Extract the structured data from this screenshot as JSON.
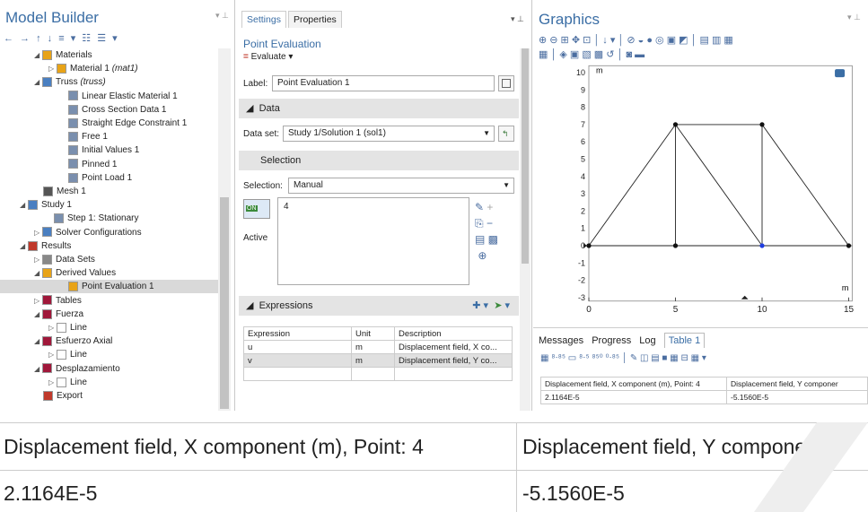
{
  "model_builder": {
    "title": "Model Builder",
    "toolbar_glyphs": "← → ↑ ↓ ≡ ▾ ☷ ☰ ▾",
    "tree": [
      {
        "indent": 48,
        "arrow": "◢",
        "icon": "#e8a317",
        "label": "Materials",
        "italic": ""
      },
      {
        "indent": 64,
        "arrow": "▷",
        "icon": "#e8a317",
        "label": "Material 1 ",
        "italic": "(mat1)"
      },
      {
        "indent": 48,
        "arrow": "◢",
        "icon": "#4a7fc1",
        "label": "Truss ",
        "italic": "(truss)"
      },
      {
        "indent": 76,
        "arrow": "",
        "icon": "#7a8fae",
        "label": "Linear Elastic Material 1",
        "italic": ""
      },
      {
        "indent": 76,
        "arrow": "",
        "icon": "#7a8fae",
        "label": "Cross Section Data 1",
        "italic": ""
      },
      {
        "indent": 76,
        "arrow": "",
        "icon": "#7a8fae",
        "label": "Straight Edge Constraint 1",
        "italic": ""
      },
      {
        "indent": 76,
        "arrow": "",
        "icon": "#7a8fae",
        "label": "Free 1",
        "italic": ""
      },
      {
        "indent": 76,
        "arrow": "",
        "icon": "#7a8fae",
        "label": "Initial Values 1",
        "italic": ""
      },
      {
        "indent": 76,
        "arrow": "",
        "icon": "#7a8fae",
        "label": "Pinned 1",
        "italic": ""
      },
      {
        "indent": 76,
        "arrow": "",
        "icon": "#7a8fae",
        "label": "Point Load 1",
        "italic": ""
      },
      {
        "indent": 48,
        "arrow": "",
        "icon": "#555",
        "label": "Mesh 1",
        "italic": ""
      },
      {
        "indent": 32,
        "arrow": "◢",
        "icon": "#4a7fc1",
        "label": "Study 1",
        "italic": ""
      },
      {
        "indent": 60,
        "arrow": "",
        "icon": "#7a8fae",
        "label": "Step 1: Stationary",
        "italic": ""
      },
      {
        "indent": 48,
        "arrow": "▷",
        "icon": "#4a7fc1",
        "label": "Solver Configurations",
        "italic": ""
      },
      {
        "indent": 32,
        "arrow": "◢",
        "icon": "#c0392b",
        "label": "Results",
        "italic": ""
      },
      {
        "indent": 48,
        "arrow": "▷",
        "icon": "#888",
        "label": "Data Sets",
        "italic": ""
      },
      {
        "indent": 48,
        "arrow": "◢",
        "icon": "#e8a317",
        "label": "Derived Values",
        "italic": ""
      },
      {
        "indent": 76,
        "arrow": "",
        "icon": "#e8a317",
        "label": "Point Evaluation 1",
        "italic": ""
      },
      {
        "indent": 48,
        "arrow": "▷",
        "icon": "#a0173a",
        "label": "Tables",
        "italic": ""
      },
      {
        "indent": 48,
        "arrow": "◢",
        "icon": "#a0173a",
        "label": "Fuerza",
        "italic": ""
      },
      {
        "indent": 64,
        "arrow": "▷",
        "icon": "#fff",
        "label": "Line",
        "italic": ""
      },
      {
        "indent": 48,
        "arrow": "◢",
        "icon": "#a0173a",
        "label": "Esfuerzo Axial",
        "italic": ""
      },
      {
        "indent": 64,
        "arrow": "▷",
        "icon": "#fff",
        "label": "Line",
        "italic": ""
      },
      {
        "indent": 48,
        "arrow": "◢",
        "icon": "#a0173a",
        "label": "Desplazamiento",
        "italic": ""
      },
      {
        "indent": 64,
        "arrow": "▷",
        "icon": "#fff",
        "label": "Line",
        "italic": ""
      },
      {
        "indent": 48,
        "arrow": "",
        "icon": "#c0392b",
        "label": "Export",
        "italic": ""
      }
    ],
    "selected_index": 17
  },
  "settings": {
    "tab_settings": "Settings",
    "tab_properties": "Properties",
    "node_title": "Point Evaluation",
    "evaluate_label": "Evaluate",
    "label_caption": "Label:",
    "label_value": "Point Evaluation 1",
    "data_section": "Data",
    "dataset_caption": "Data set:",
    "dataset_value": "Study 1/Solution 1 (sol1)",
    "selection_section": "Selection",
    "selection_caption": "Selection:",
    "selection_value": "Manual",
    "selection_list_value": "4",
    "toggle_text": "ON",
    "active_label": "Active",
    "expressions_section": "Expressions",
    "expr_headers": [
      "Expression",
      "Unit",
      "Description"
    ],
    "expr_rows": [
      [
        "u",
        "m",
        "Displacement field, X co..."
      ],
      [
        "v",
        "m",
        "Displacement field, Y co..."
      ],
      [
        "",
        "",
        ""
      ]
    ]
  },
  "graphics": {
    "title": "Graphics",
    "toolbar1": "⊕ ⊖ ⊞ ✥ ⊡ │ ↓ ▾ │ ⊘ ◒ ● ◎ ▣ ◩ │ ▤ ▥ ▦",
    "toolbar2": "▦ │ ◈ ▣ ▧ ▩ ↺ │ ◙ ▬",
    "unit_label": "m",
    "x_ticks": [
      "0",
      "5",
      "10",
      "15"
    ],
    "y_ticks": [
      "10",
      "9",
      "8",
      "7",
      "6",
      "5",
      "4",
      "3",
      "2",
      "1",
      "0",
      "-1",
      "-2",
      "-3"
    ]
  },
  "messages": {
    "tabs": [
      "Messages",
      "Progress",
      "Log",
      "Table 1"
    ],
    "toolbar": "▦ ⁸⋅⁸⁵ ▭ ⁸⋅⁵ ⁸⁵⁰ ⁰⋅⁸⁵ │ ✎ ◫ ▤ ■ ▦ ⊟ ▦ ▾",
    "col1_header": "Displacement field, X component (m), Point: 4",
    "col2_header": "Displacement field, Y componer",
    "col1_value": "2.1164E-5",
    "col2_value": "-5.1560E-5"
  },
  "zoom": {
    "col1_header": "Displacement field, X component (m), Point: 4",
    "col2_header": "Displacement field, Y componer",
    "col1_value": "2.1164E-5",
    "col2_value": "-5.1560E-5"
  }
}
